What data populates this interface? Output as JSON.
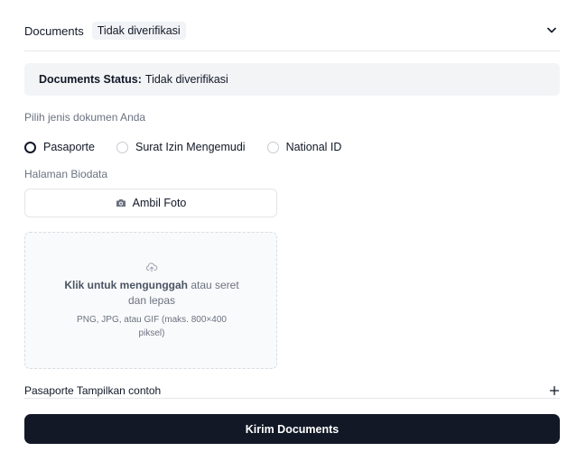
{
  "header": {
    "title": "Documents",
    "badge": "Tidak diverifikasi",
    "chevron_icon": "chevron-down-icon"
  },
  "status": {
    "label": "Documents Status:",
    "value": "Tidak diverifikasi"
  },
  "doc_type": {
    "label": "Pilih jenis dokumen Anda",
    "options": [
      {
        "label": "Pasaporte",
        "checked": true
      },
      {
        "label": "Surat Izin Mengemudi",
        "checked": false
      },
      {
        "label": "National ID",
        "checked": false
      }
    ]
  },
  "biodata": {
    "label": "Halaman Biodata",
    "photo_button": "Ambil Foto",
    "camera_icon": "camera-icon"
  },
  "dropzone": {
    "upload_icon": "upload-cloud-icon",
    "click_text": "Klik untuk mengunggah",
    "drag_text": " atau seret dan lepas",
    "formats": "PNG, JPG, atau GIF (maks. 800×400 piksel)"
  },
  "sample": {
    "text": "Pasaporte Tampilkan contoh",
    "plus_icon": "plus-icon"
  },
  "submit": {
    "label": "Kirim Documents"
  },
  "colors": {
    "primary_button": "#121826",
    "status_bg": "#f3f4f6",
    "muted_text": "#6b7280"
  }
}
